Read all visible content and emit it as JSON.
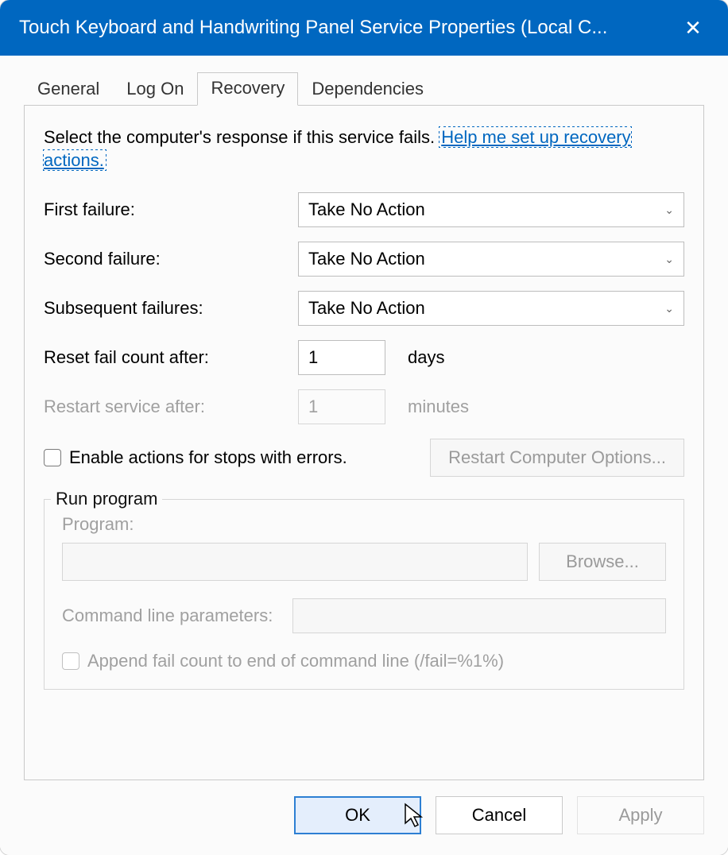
{
  "window": {
    "title": "Touch Keyboard and Handwriting Panel Service Properties (Local C...",
    "close_glyph": "✕"
  },
  "tabs": {
    "general": "General",
    "logon": "Log On",
    "recovery": "Recovery",
    "dependencies": "Dependencies"
  },
  "intro": {
    "text": "Select the computer's response if this service fails.",
    "link": "Help me set up recovery actions."
  },
  "failures": {
    "first_label": "First failure:",
    "first_value": "Take No Action",
    "second_label": "Second failure:",
    "second_value": "Take No Action",
    "subsequent_label": "Subsequent failures:",
    "subsequent_value": "Take No Action"
  },
  "reset": {
    "label": "Reset fail count after:",
    "value": "1",
    "unit": "days"
  },
  "restart_service": {
    "label": "Restart service after:",
    "value": "1",
    "unit": "minutes"
  },
  "enable_actions_label": "Enable actions for stops with errors.",
  "restart_computer_options": "Restart Computer Options...",
  "run_program": {
    "legend": "Run program",
    "program_label": "Program:",
    "program_value": "",
    "browse": "Browse...",
    "cmd_label": "Command line parameters:",
    "cmd_value": "",
    "append_label": "Append fail count to end of command line (/fail=%1%)"
  },
  "buttons": {
    "ok": "OK",
    "cancel": "Cancel",
    "apply": "Apply"
  }
}
